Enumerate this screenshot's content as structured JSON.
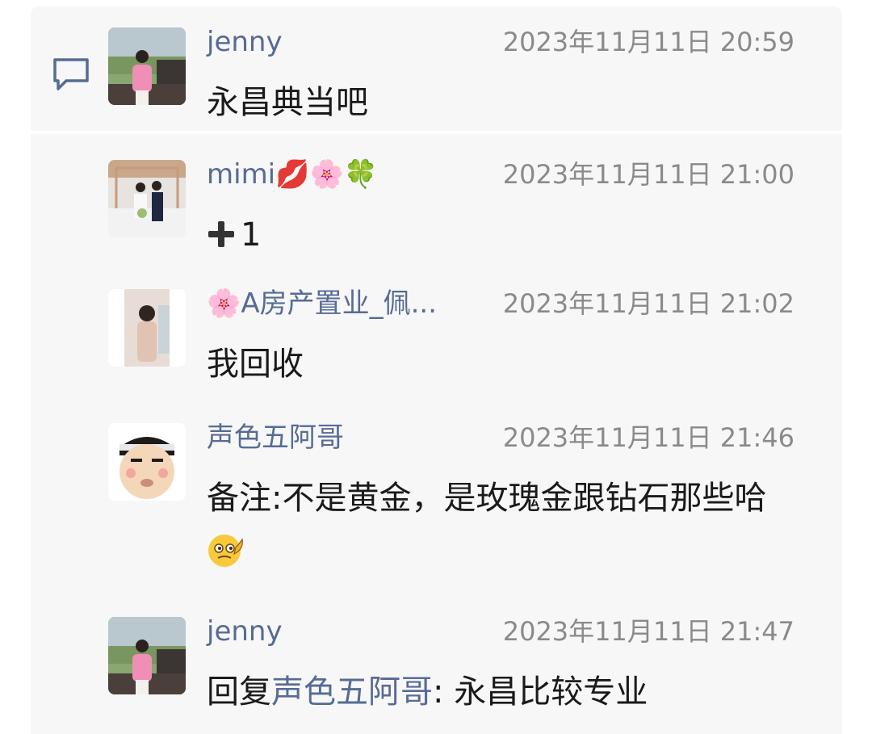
{
  "comments": [
    {
      "author": "jenny",
      "time": "2023年11月11日 20:59",
      "text": "永昌典当吧"
    },
    {
      "author": "mimi",
      "author_emojis": [
        "💋",
        "🌸",
        "🍀"
      ],
      "time": "2023年11月11日 21:00",
      "text": "1",
      "text_prefix_icon": "plus-icon"
    },
    {
      "author_emoji": "🌸",
      "author": "A房产置业_佩...",
      "time": "2023年11月11日 21:02",
      "text": "我回收"
    },
    {
      "author": "声色五阿哥",
      "time": "2023年11月11日 21:46",
      "text": "备注:不是黄金，是玫瑰金跟钻石那些哈",
      "text_suffix_icon": "thinking-emoji"
    },
    {
      "author": "jenny",
      "time": "2023年11月11日 21:47",
      "reply_prefix": "回复",
      "reply_to": "声色五阿哥",
      "text": ": 永昌比较专业"
    }
  ],
  "icons": {
    "comment": "comment-bubble-icon"
  },
  "colors": {
    "name_link": "#576b95",
    "timestamp": "#8a8a8a",
    "card_background": "#f7f7f7"
  }
}
